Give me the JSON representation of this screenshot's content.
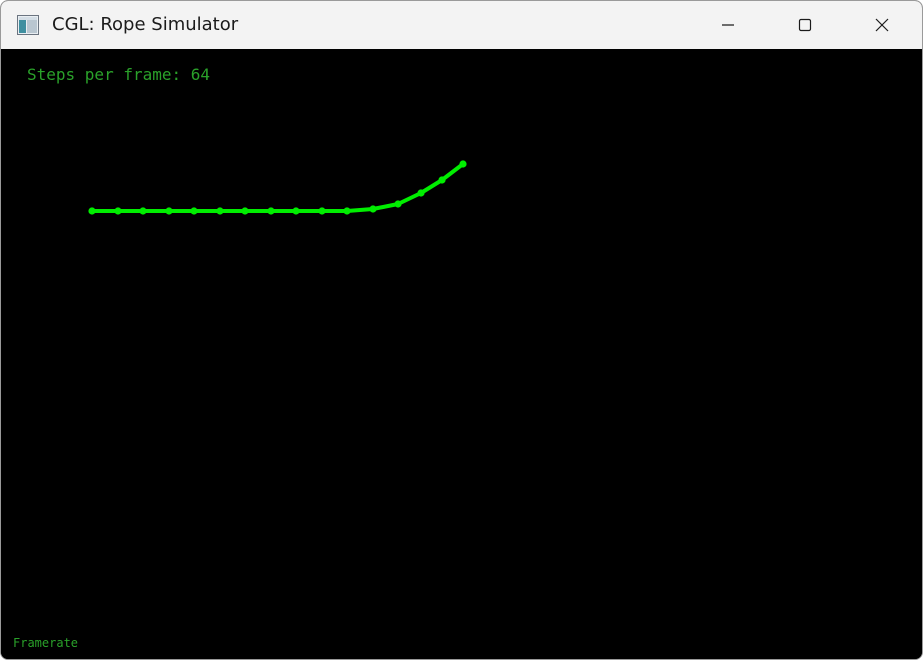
{
  "window": {
    "title": "CGL: Rope Simulator",
    "icon": "app-window-icon",
    "controls": {
      "minimize_icon": "minimize-icon",
      "maximize_icon": "maximize-icon",
      "close_icon": "close-icon"
    }
  },
  "overlay": {
    "steps_text": "Steps per frame: 64",
    "framerate_text": "Framerate"
  },
  "colors": {
    "rope": "#00ee00",
    "overlay_text": "#2aa12a",
    "background": "#000000",
    "titlebar": "#f3f3f3"
  }
}
